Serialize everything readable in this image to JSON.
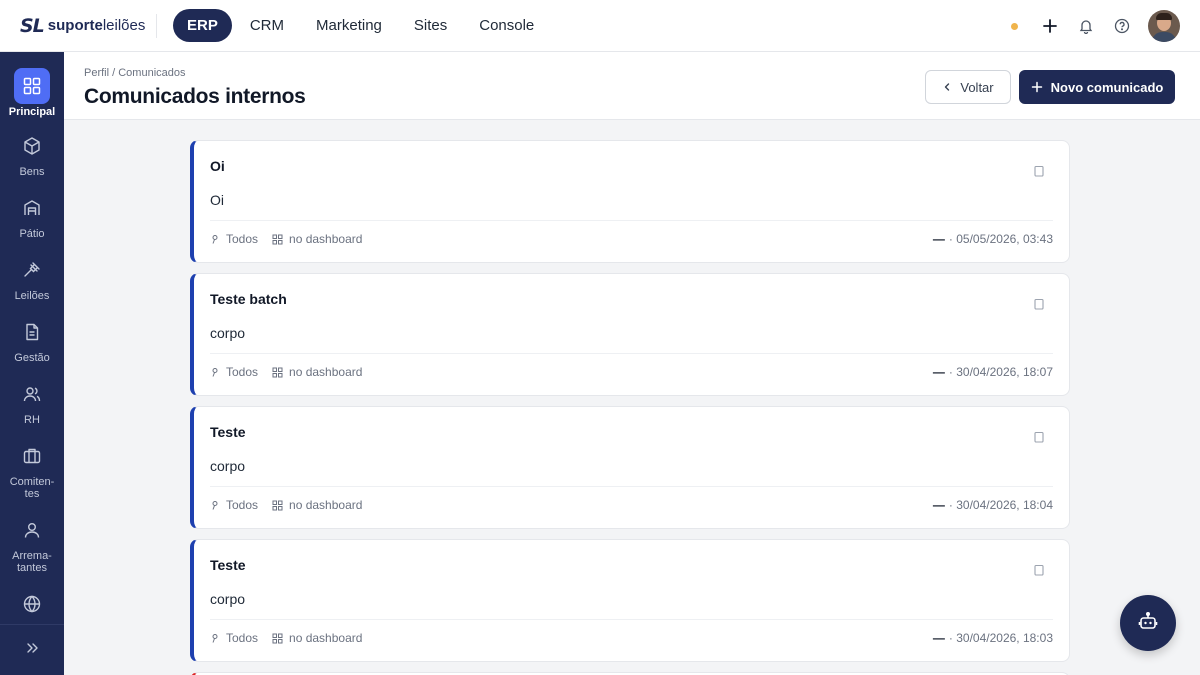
{
  "brand": {
    "mark": "SL",
    "name_bold": "suporte",
    "name_light": "leilões"
  },
  "topnav": [
    {
      "label": "ERP",
      "active": true
    },
    {
      "label": "CRM",
      "active": false
    },
    {
      "label": "Marketing",
      "active": false
    },
    {
      "label": "Sites",
      "active": false
    },
    {
      "label": "Console",
      "active": false
    }
  ],
  "topbar_icons": [
    "status-dot",
    "plus-icon",
    "bell-icon",
    "help-icon",
    "avatar"
  ],
  "sidebar": {
    "items": [
      {
        "label": "Principal",
        "icon": "grid-icon",
        "active": true
      },
      {
        "label": "Bens",
        "icon": "box-icon"
      },
      {
        "label": "Pátio",
        "icon": "warehouse-icon"
      },
      {
        "label": "Leilões",
        "icon": "gavel-icon"
      },
      {
        "label": "Gestão",
        "icon": "document-icon"
      },
      {
        "label": "RH",
        "icon": "users-icon"
      },
      {
        "label": "Comiten-tes",
        "line1": "Comiten-",
        "line2": "tes",
        "icon": "briefcase-icon"
      },
      {
        "label": "Arrema-tantes",
        "line1": "Arrema-",
        "line2": "tantes",
        "icon": "user-icon"
      },
      {
        "label": "",
        "icon": "globe-icon"
      }
    ],
    "expand_icon": "chevrons-right-icon"
  },
  "header": {
    "breadcrumb": "Perfil / Comunicados",
    "title": "Comunicados internos",
    "back_label": "Voltar",
    "new_label": "Novo comunicado"
  },
  "cards": [
    {
      "title": "Oi",
      "body": "Oi",
      "audience": "Todos",
      "placement": "no dashboard",
      "author": "—",
      "date": "· 05/05/2026, 03:43"
    },
    {
      "title": "Teste batch",
      "body": "corpo",
      "audience": "Todos",
      "placement": "no dashboard",
      "author": "—",
      "date": "· 30/04/2026, 18:07"
    },
    {
      "title": "Teste",
      "body": "corpo",
      "audience": "Todos",
      "placement": "no dashboard",
      "author": "—",
      "date": "· 30/04/2026, 18:04"
    },
    {
      "title": "Teste",
      "body": "corpo",
      "audience": "Todos",
      "placement": "no dashboard",
      "author": "—",
      "date": "· 30/04/2026, 18:03"
    }
  ],
  "colors": {
    "primary": "#1f2a55",
    "active_sidebar": "#4f6df5",
    "card_accent": "#1e40af",
    "status_dot": "#f0b44c"
  }
}
